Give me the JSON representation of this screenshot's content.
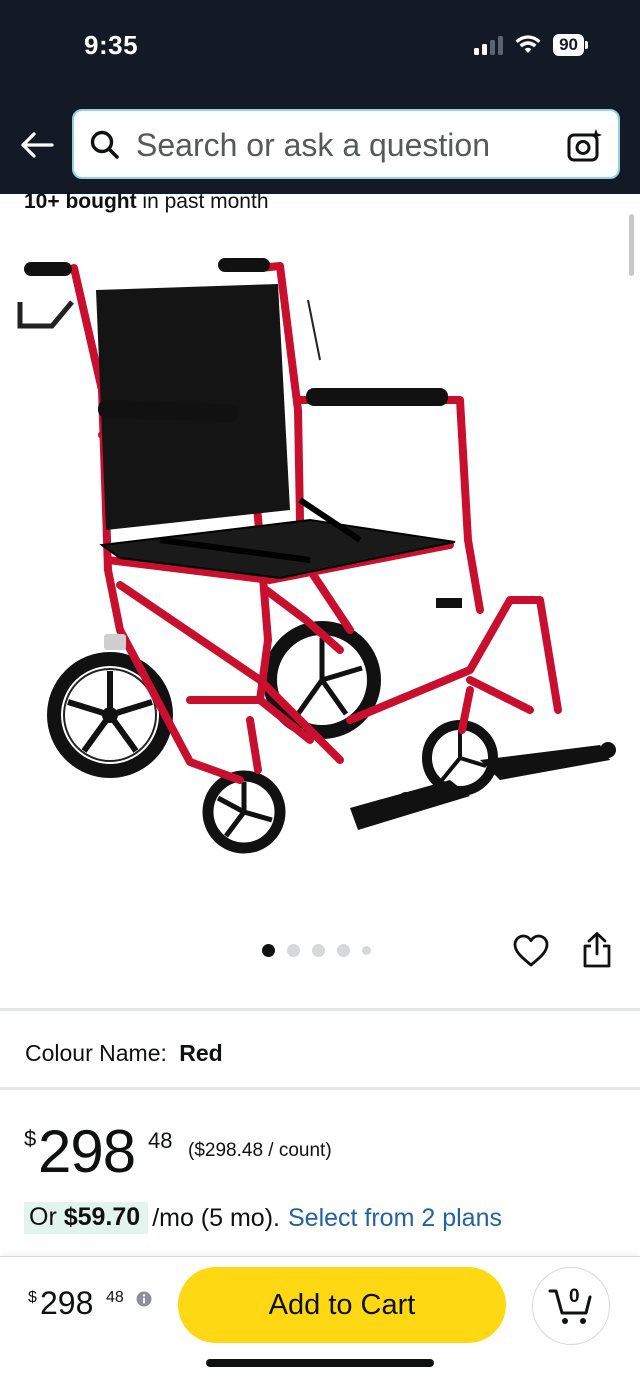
{
  "status_bar": {
    "time": "9:35",
    "battery": "90"
  },
  "search": {
    "placeholder": "Search or ask a question"
  },
  "product": {
    "bought_count": "10+ bought",
    "bought_suffix": " in past month",
    "image_count": 5,
    "active_image": 1,
    "colour_label": "Colour Name:",
    "colour_value": "Red",
    "price_symbol": "$",
    "price_whole": "298",
    "price_fraction": "48",
    "price_per_unit": "($298.48 / count)",
    "instalment_prefix": "Or ",
    "instalment_amount": "$59.70",
    "instalment_terms": "/mo (5 mo).",
    "instalment_link": "Select from 2 plans"
  },
  "bottom_bar": {
    "price_symbol": "$",
    "price_whole": "298",
    "price_fraction": "48",
    "add_to_cart_label": "Add to Cart",
    "cart_count": "0"
  },
  "colors": {
    "header_bg": "#131a26",
    "add_to_cart_bg": "#ffd814",
    "link": "#2162a1",
    "instalment_badge_bg": "#e3f4ee",
    "wheelchair_frame": "#c8102e"
  },
  "icons": [
    "back-arrow-icon",
    "search-icon",
    "camera-lens-icon",
    "heart-icon",
    "share-icon",
    "info-icon",
    "cart-icon",
    "wifi-icon",
    "signal-icon",
    "battery-icon"
  ]
}
